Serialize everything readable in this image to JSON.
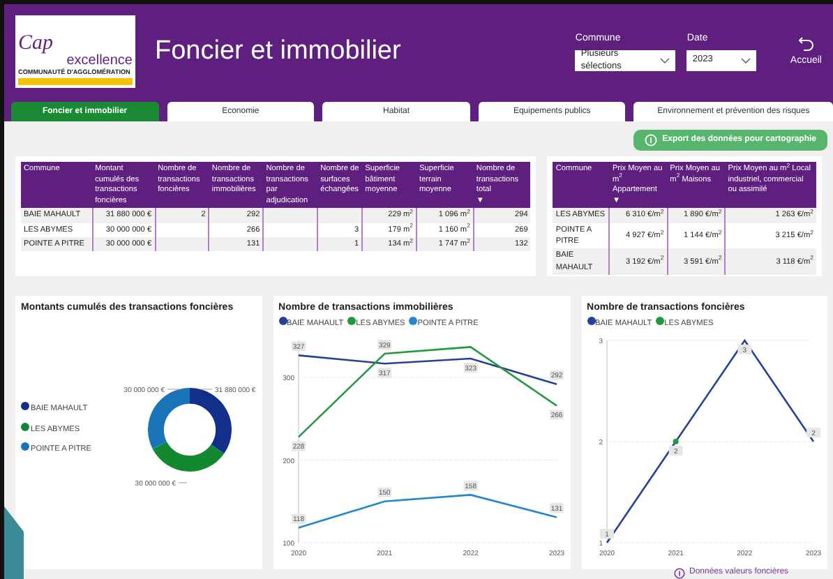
{
  "header": {
    "logo": {
      "word_1": "Cap",
      "word_2": "excellence",
      "subtitle": "COMMUNAUTÉ D'AGGLOMÉRATION"
    },
    "title": "Foncier et immobilier",
    "filters": [
      {
        "label": "Commune",
        "value": "Plusieurs sélections"
      },
      {
        "label": "Date",
        "value": "2023"
      }
    ],
    "home_button": "Accueil"
  },
  "tabs": [
    {
      "label": "Foncier et immobilier",
      "selected": true
    },
    {
      "label": "Economie",
      "selected": false
    },
    {
      "label": "Habitat",
      "selected": false
    },
    {
      "label": "Equipements publics",
      "selected": false
    },
    {
      "label": "Environnement et prévention des risques",
      "selected": false
    }
  ],
  "export_button": "Export des données pour cartographie",
  "transactions_table": {
    "columns": [
      "Commune",
      "Montant cumulés des transactions foncières",
      "Nombre de transactions foncières",
      "Nombre de transactions immobilières",
      "Nombre de transactions par adjudication",
      "Nombre de surfaces échangées",
      "Superficie bâtiment moyenne",
      "Superficie terrain moyenne",
      "Nombre de transactions total"
    ],
    "sort_marker": "▼",
    "rows": [
      [
        "BAIE MAHAULT",
        "31 880 000 €",
        "2",
        "292",
        "",
        "",
        "229 m$^{2}$",
        "1 096 m$^{2}$",
        "294"
      ],
      [
        "LES ABYMES",
        "30 000 000 €",
        "",
        "266",
        "",
        "3",
        "179 m$^{2}$",
        "1 160 m$^{2}$",
        "269"
      ],
      [
        "POINTE A PITRE",
        "30 000 000 €",
        "",
        "131",
        "",
        "1",
        "134 m$^{2}$",
        "1 747 m$^{2}$",
        "132"
      ]
    ]
  },
  "prices_table": {
    "columns": [
      "Commune",
      "Prix Moyen au m$^{2}$ Appartement",
      "Prix Moyen au m$^{2}$ Maisons",
      "Prix Moyen au m$^{2}$ Local industriel, commercial ou assimilé"
    ],
    "sort_marker": "▼",
    "rows": [
      [
        "LES ABYMES",
        "6 310 €/m$^{2}$",
        "1 890 €/m$^{2}$",
        "1 263 €/m$^{2}$"
      ],
      [
        "POINTE A PITRE",
        "4 927 €/m$^{2}$",
        "1 144 €/m$^{2}$",
        "3 215 €/m$^{2}$"
      ],
      [
        "BAIE MAHAULT",
        "3 192 €/m$^{2}$",
        "3 591 €/m$^{2}$",
        "3 118 €/m$^{2}$"
      ]
    ]
  },
  "donut_panel": {
    "chart_data": {
      "type": "donut",
      "title": "Montants cumulés des transactions foncières",
      "categories": [
        "BAIE MAHAULT",
        "LES ABYMES",
        "POINTE A PITRE"
      ],
      "values": [
        31880000,
        30000000,
        30000000
      ],
      "colors": [
        "#12308a",
        "#12892f",
        "#1a74b8"
      ],
      "value_labels": [
        "31 880 000 €",
        "30 000 000 €",
        "30 000 000 €"
      ]
    }
  },
  "immo_panel": {
    "chart_data": {
      "type": "line",
      "title": "Nombre de transactions immobilières",
      "x": [
        "2020",
        "2021",
        "2022",
        "2023"
      ],
      "ylim": [
        100,
        345
      ],
      "yticks": [
        100,
        200,
        300
      ],
      "series": [
        {
          "name": "BAIE MAHAULT",
          "color": "#24409a",
          "values": [
            327,
            317,
            323,
            292
          ],
          "value_labels": [
            "327",
            "317",
            "323",
            "292"
          ]
        },
        {
          "name": "LES ABYMES",
          "color": "#1f9a3c",
          "values": [
            228,
            329,
            337,
            266
          ],
          "value_labels": [
            "228",
            "329",
            null,
            "266"
          ]
        },
        {
          "name": "POINTE A PITRE",
          "color": "#2486cc",
          "values": [
            118,
            150,
            158,
            131
          ],
          "value_labels": [
            "118",
            "150",
            "158",
            "131"
          ]
        }
      ]
    }
  },
  "foncier_panel": {
    "chart_data": {
      "type": "line",
      "title": "Nombre de transactions foncières",
      "x": [
        "2020",
        "2021",
        "2022",
        "2023"
      ],
      "ylim": [
        1,
        3
      ],
      "yticks": [
        1,
        2,
        3
      ],
      "series": [
        {
          "name": "BAIE MAHAULT",
          "color": "#24409a",
          "values": [
            1,
            2,
            3,
            2
          ],
          "value_labels": [
            "1",
            "2",
            "3",
            "2"
          ]
        },
        {
          "name": "LES ABYMES",
          "color": "#1f9a3c",
          "marker": true,
          "values": [
            null,
            2,
            null,
            null
          ],
          "value_labels": [
            null,
            null,
            null,
            null
          ]
        }
      ]
    }
  },
  "footer_link": "Données valeurs foncières"
}
